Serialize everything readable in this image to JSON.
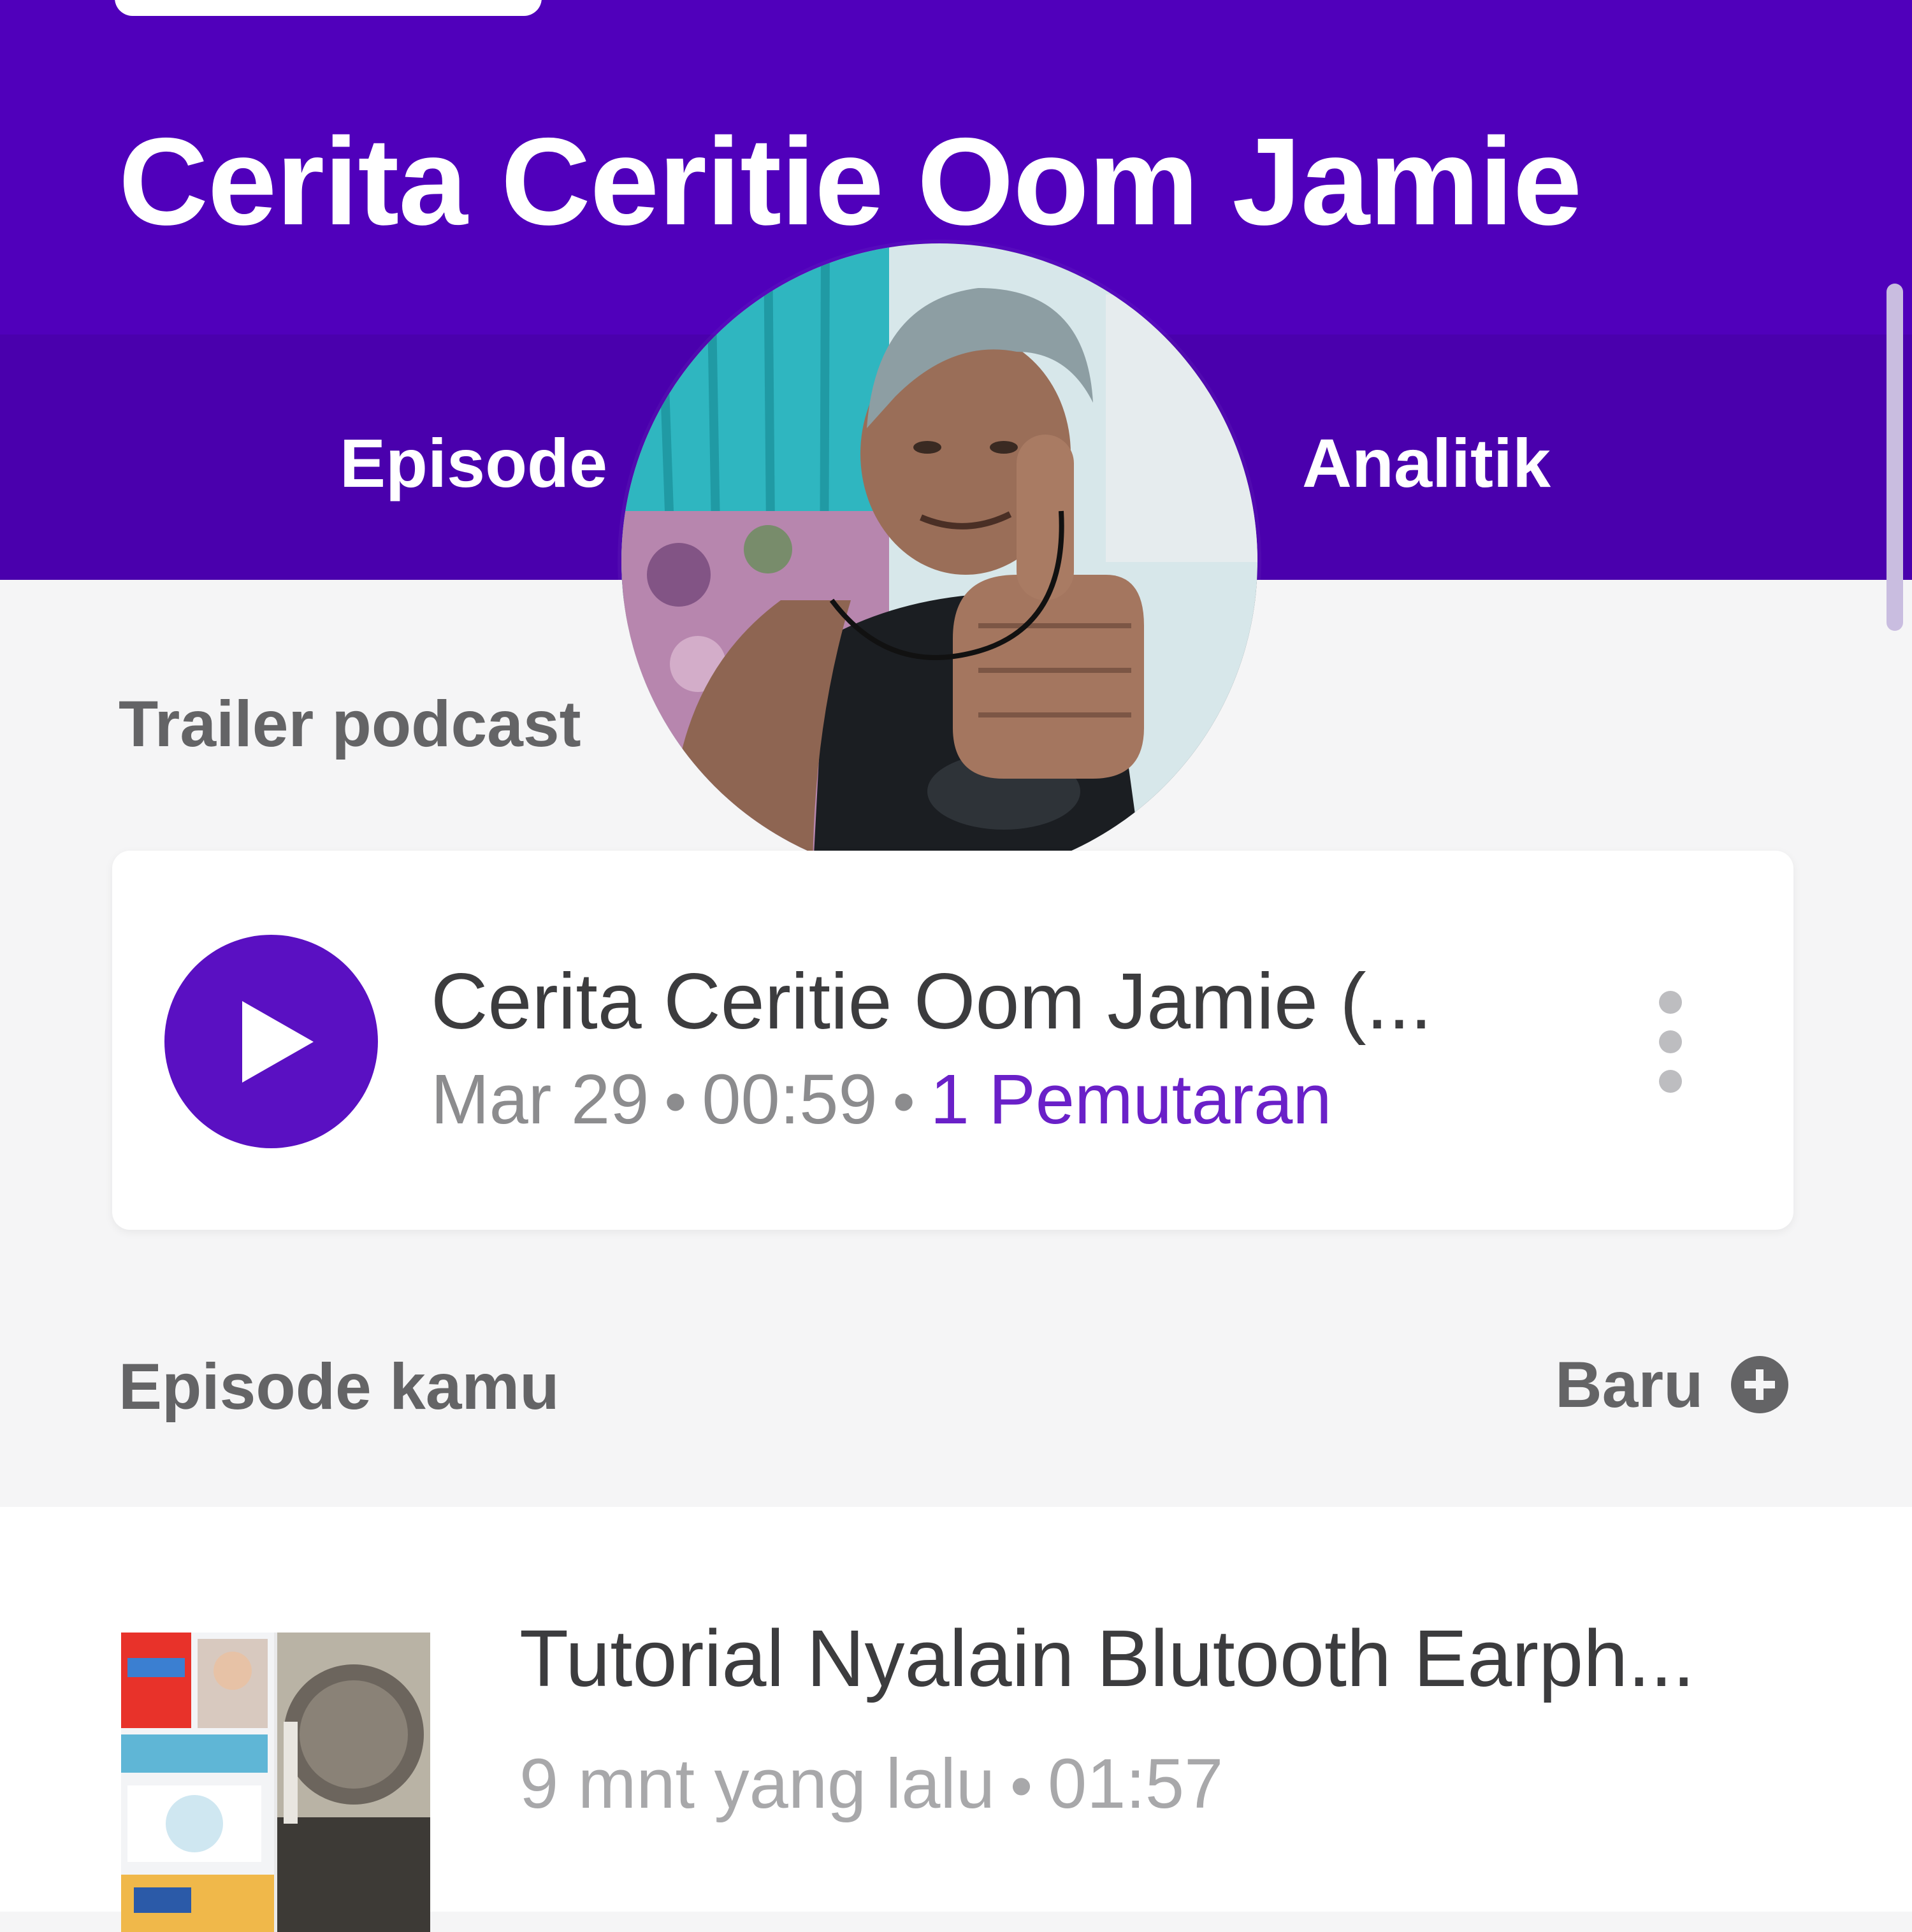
{
  "header": {
    "podcast_title": "Cerita Ceritie Oom Jamie",
    "background_color": "#5000bb"
  },
  "tabs": [
    {
      "label": "Episode",
      "active": true
    },
    {
      "label": "Analitik",
      "active": false
    }
  ],
  "avatar": {
    "description_icon": "podcast-cover-avatar"
  },
  "trailer": {
    "section_label": "Trailer podcast",
    "title": "Cerita Ceritie Oom Jamie (...",
    "date": "Mar 29",
    "duration": "00:59",
    "plays": "1 Pemutaran",
    "separator": "•",
    "accent_color": "#5a10c2"
  },
  "episodes_section": {
    "label": "Episode kamu",
    "new_label": "Baru"
  },
  "episodes": [
    {
      "title": "Tutorial Nyalain Blutooth Earph...",
      "time_ago": "9 mnt yang lalu",
      "duration": "01:57",
      "separator": "•"
    }
  ]
}
